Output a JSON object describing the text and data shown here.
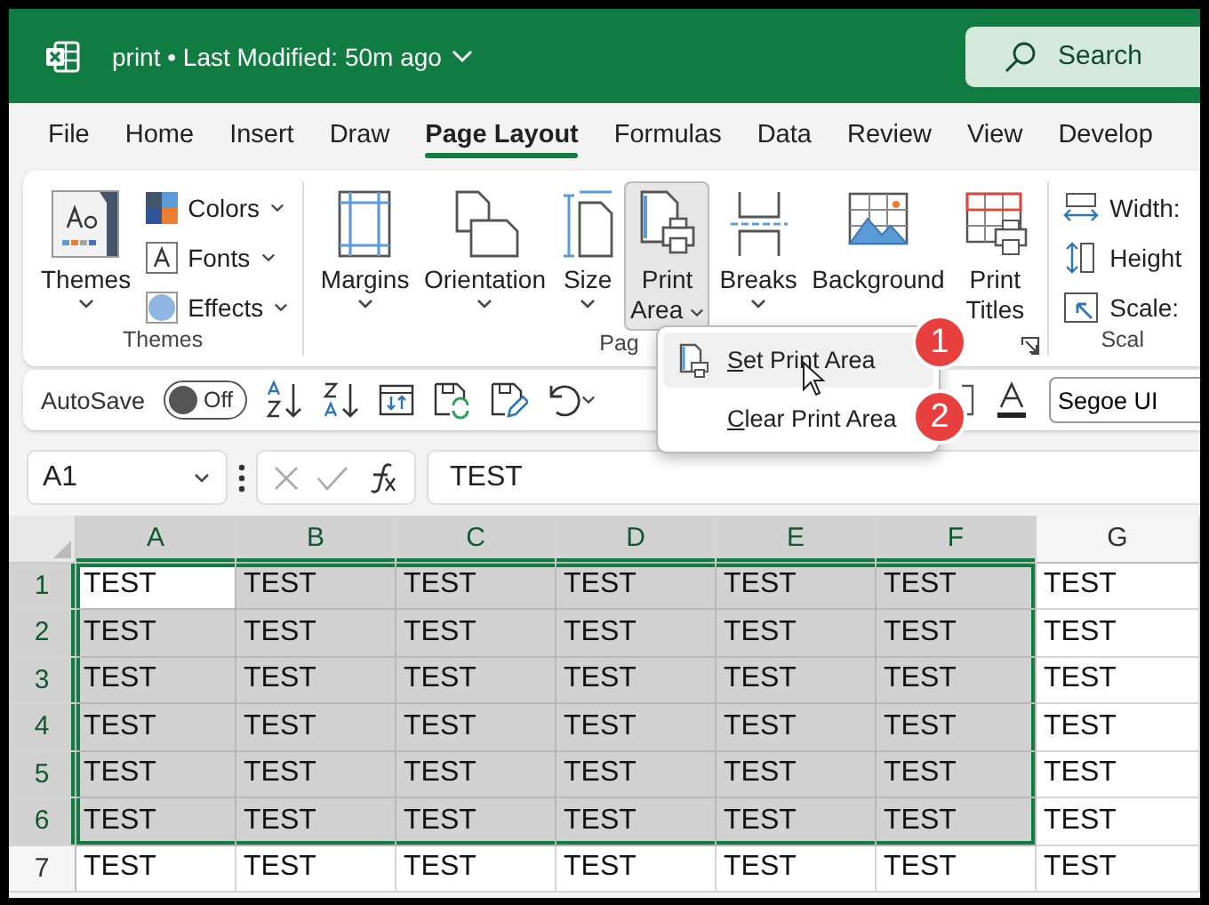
{
  "title_bar": {
    "title": "print • Last Modified: 50m ago",
    "search": {
      "placeholder": "Search"
    }
  },
  "tabs": [
    {
      "label": "File",
      "selected": false
    },
    {
      "label": "Home",
      "selected": false
    },
    {
      "label": "Insert",
      "selected": false
    },
    {
      "label": "Draw",
      "selected": false
    },
    {
      "label": "Page Layout",
      "selected": true
    },
    {
      "label": "Formulas",
      "selected": false
    },
    {
      "label": "Data",
      "selected": false
    },
    {
      "label": "Review",
      "selected": false
    },
    {
      "label": "View",
      "selected": false
    },
    {
      "label": "Develop",
      "selected": false
    }
  ],
  "ribbon": {
    "themes_group": {
      "label": "Themes",
      "main": {
        "lines": [
          "Themes"
        ],
        "dropdown": true
      },
      "small": [
        {
          "label": "Colors"
        },
        {
          "label": "Fonts"
        },
        {
          "label": "Effects"
        }
      ]
    },
    "page_setup_group": {
      "label": "Pag",
      "buttons": [
        {
          "lines": [
            "Margins"
          ],
          "dropdown": true,
          "pressed": false
        },
        {
          "lines": [
            "Orientation"
          ],
          "dropdown": true,
          "pressed": false
        },
        {
          "lines": [
            "Size"
          ],
          "dropdown": true,
          "pressed": false
        },
        {
          "lines": [
            "Print",
            "Area"
          ],
          "dropdown": true,
          "pressed": true
        },
        {
          "lines": [
            "Breaks"
          ],
          "dropdown": true,
          "pressed": false
        },
        {
          "lines": [
            "Background"
          ],
          "dropdown": false,
          "pressed": false
        },
        {
          "lines": [
            "Print",
            "Titles"
          ],
          "dropdown": false,
          "pressed": false
        }
      ]
    },
    "scale_group": {
      "label": "Scal",
      "items": [
        {
          "label": "Width:"
        },
        {
          "label": "Height"
        },
        {
          "label": "Scale:"
        }
      ]
    }
  },
  "print_area_menu": {
    "items": [
      {
        "label_parts": [
          {
            "text": "S",
            "underlined": true
          },
          {
            "text": "et Print Area",
            "underlined": false
          }
        ],
        "hovered": true,
        "badge": "1"
      },
      {
        "label_parts": [
          {
            "text": "C",
            "underlined": true
          },
          {
            "text": "lear Print Area",
            "underlined": false
          }
        ],
        "hovered": false,
        "badge": "2"
      }
    ]
  },
  "quick_access": {
    "autosave": {
      "label": "AutoSave",
      "on": false,
      "state_text": "Off"
    },
    "font_field": {
      "value": "Segoe UI"
    }
  },
  "formula_bar": {
    "name_box": "A1",
    "value": "TEST"
  },
  "grid": {
    "columns": [
      {
        "label": "A",
        "selected": true
      },
      {
        "label": "B",
        "selected": true
      },
      {
        "label": "C",
        "selected": true
      },
      {
        "label": "D",
        "selected": true
      },
      {
        "label": "E",
        "selected": true
      },
      {
        "label": "F",
        "selected": true
      },
      {
        "label": "G",
        "selected": false
      }
    ],
    "rows": [
      {
        "header": "1",
        "selected": true,
        "cells": [
          {
            "text": "TEST",
            "selected": true,
            "active": true
          },
          {
            "text": "TEST",
            "selected": true,
            "active": false
          },
          {
            "text": "TEST",
            "selected": true,
            "active": false
          },
          {
            "text": "TEST",
            "selected": true,
            "active": false
          },
          {
            "text": "TEST",
            "selected": true,
            "active": false
          },
          {
            "text": "TEST",
            "selected": true,
            "active": false
          },
          {
            "text": "TEST",
            "selected": false,
            "active": false
          }
        ]
      },
      {
        "header": "2",
        "selected": true,
        "cells": [
          {
            "text": "TEST",
            "selected": true,
            "active": false
          },
          {
            "text": "TEST",
            "selected": true,
            "active": false
          },
          {
            "text": "TEST",
            "selected": true,
            "active": false
          },
          {
            "text": "TEST",
            "selected": true,
            "active": false
          },
          {
            "text": "TEST",
            "selected": true,
            "active": false
          },
          {
            "text": "TEST",
            "selected": true,
            "active": false
          },
          {
            "text": "TEST",
            "selected": false,
            "active": false
          }
        ]
      },
      {
        "header": "3",
        "selected": true,
        "cells": [
          {
            "text": "TEST",
            "selected": true,
            "active": false
          },
          {
            "text": "TEST",
            "selected": true,
            "active": false
          },
          {
            "text": "TEST",
            "selected": true,
            "active": false
          },
          {
            "text": "TEST",
            "selected": true,
            "active": false
          },
          {
            "text": "TEST",
            "selected": true,
            "active": false
          },
          {
            "text": "TEST",
            "selected": true,
            "active": false
          },
          {
            "text": "TEST",
            "selected": false,
            "active": false
          }
        ]
      },
      {
        "header": "4",
        "selected": true,
        "cells": [
          {
            "text": "TEST",
            "selected": true,
            "active": false
          },
          {
            "text": "TEST",
            "selected": true,
            "active": false
          },
          {
            "text": "TEST",
            "selected": true,
            "active": false
          },
          {
            "text": "TEST",
            "selected": true,
            "active": false
          },
          {
            "text": "TEST",
            "selected": true,
            "active": false
          },
          {
            "text": "TEST",
            "selected": true,
            "active": false
          },
          {
            "text": "TEST",
            "selected": false,
            "active": false
          }
        ]
      },
      {
        "header": "5",
        "selected": true,
        "cells": [
          {
            "text": "TEST",
            "selected": true,
            "active": false
          },
          {
            "text": "TEST",
            "selected": true,
            "active": false
          },
          {
            "text": "TEST",
            "selected": true,
            "active": false
          },
          {
            "text": "TEST",
            "selected": true,
            "active": false
          },
          {
            "text": "TEST",
            "selected": true,
            "active": false
          },
          {
            "text": "TEST",
            "selected": true,
            "active": false
          },
          {
            "text": "TEST",
            "selected": false,
            "active": false
          }
        ]
      },
      {
        "header": "6",
        "selected": true,
        "cells": [
          {
            "text": "TEST",
            "selected": true,
            "active": false
          },
          {
            "text": "TEST",
            "selected": true,
            "active": false
          },
          {
            "text": "TEST",
            "selected": true,
            "active": false
          },
          {
            "text": "TEST",
            "selected": true,
            "active": false
          },
          {
            "text": "TEST",
            "selected": true,
            "active": false
          },
          {
            "text": "TEST",
            "selected": true,
            "active": false
          },
          {
            "text": "TEST",
            "selected": false,
            "active": false
          }
        ]
      },
      {
        "header": "7",
        "selected": false,
        "cells": [
          {
            "text": "TEST",
            "selected": false,
            "active": false
          },
          {
            "text": "TEST",
            "selected": false,
            "active": false
          },
          {
            "text": "TEST",
            "selected": false,
            "active": false
          },
          {
            "text": "TEST",
            "selected": false,
            "active": false
          },
          {
            "text": "TEST",
            "selected": false,
            "active": false
          },
          {
            "text": "TEST",
            "selected": false,
            "active": false
          },
          {
            "text": "TEST",
            "selected": false,
            "active": false
          }
        ]
      }
    ]
  }
}
